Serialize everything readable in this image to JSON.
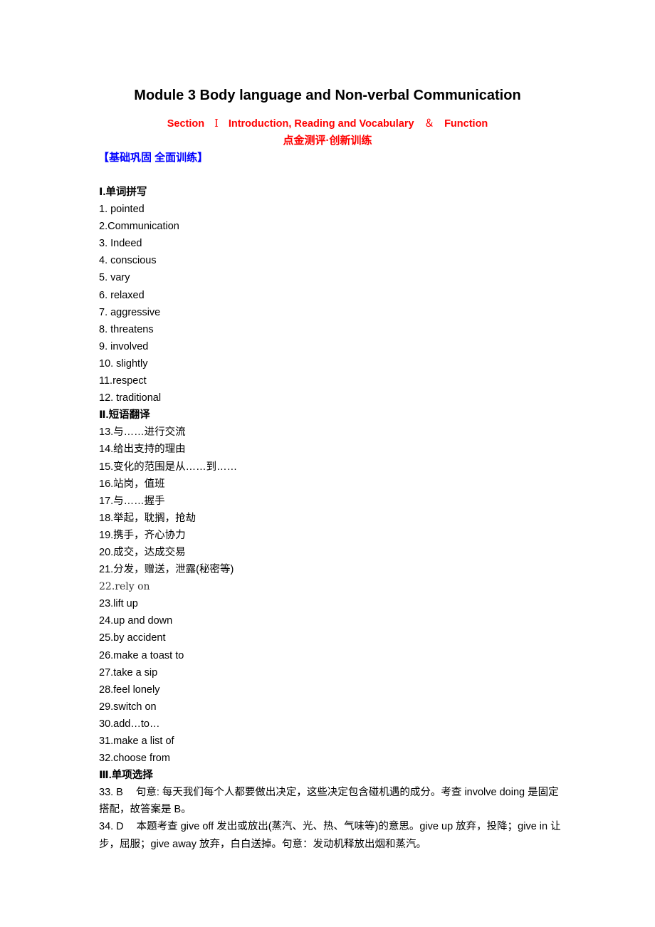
{
  "document": {
    "title": "Module 3 Body language and Non-verbal Communication",
    "section": {
      "prefix": "Section",
      "numeral": "Ⅰ",
      "name": "Introduction, Reading and Vocabulary",
      "amp": "＆",
      "suffix": "Function"
    },
    "subtitle": "点金测评·创新训练",
    "block_heading": "【基础巩固  全面训练】"
  },
  "part1": {
    "heading": "Ⅰ.单词拼写",
    "items": [
      "1. pointed",
      "2.Communication",
      "3. Indeed",
      "4. conscious",
      "5. vary",
      "6. relaxed",
      "7. aggressive",
      "8. threatens",
      "9. involved",
      "10. slightly",
      "11.respect",
      "12. traditional"
    ]
  },
  "part2": {
    "heading": "Ⅱ.短语翻译",
    "items": [
      "13.与……进行交流",
      "14.给出支持的理由",
      "15.变化的范围是从……到……",
      "16.站岗，值班",
      "17.与……握手",
      "18.举起，耽搁，抢劫",
      "19.携手，齐心协力",
      "20.成交，达成交易",
      "21.分发，赠送，泄露(秘密等)",
      "22.rely on",
      "23.lift up",
      "24.up and down",
      "25.by accident",
      "26.make a toast to",
      "27.take a sip",
      "28.feel lonely",
      "29.switch on",
      "30.add…to…",
      "31.make a list of",
      "32.choose from"
    ]
  },
  "part3": {
    "heading": "Ⅲ.单项选择",
    "items": [
      {
        "number": "33. B",
        "text": "句意: 每天我们每个人都要做出决定，这些决定包含碰机遇的成分。考查 involve doing 是固定搭配，故答案是 B。"
      },
      {
        "number": "34. D",
        "text": "本题考查 give off 发出或放出(蒸汽、光、热、气味等)的意思。give up 放弃，投降；give in 让步，屈服；give away 放弃，白白送掉。句意：发动机释放出烟和蒸汽。"
      }
    ]
  },
  "colors": {
    "section_red": "#ff0000",
    "heading_blue": "#0000ff",
    "text": "#000000"
  }
}
